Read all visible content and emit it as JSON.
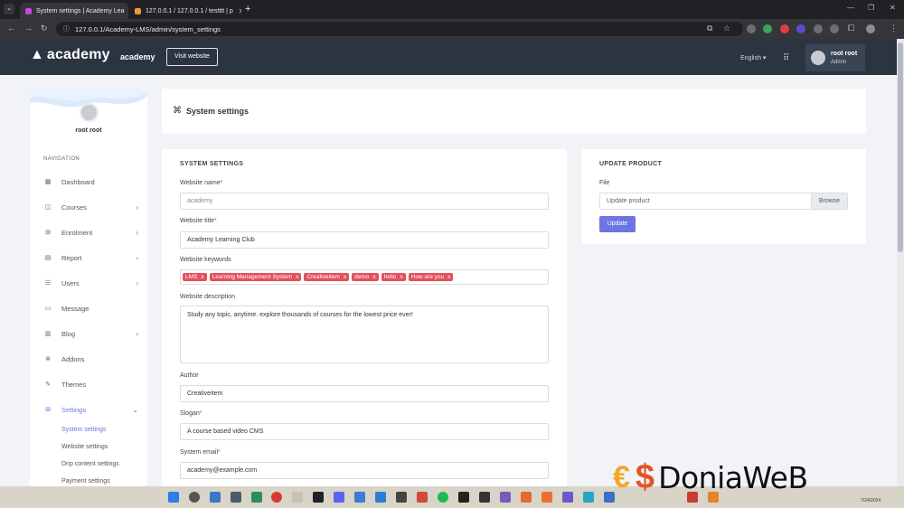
{
  "browser": {
    "tabs": [
      {
        "title": "System settings | Academy Lea",
        "active": true
      },
      {
        "title": "127.0.0.1 / 127.0.0.1 / testttt | p",
        "active": false
      }
    ],
    "url": "127.0.0.1/Academy-LMS/admin/system_settings"
  },
  "header": {
    "logo_text": "academy",
    "site_name": "academy",
    "visit_website": "Visit website",
    "language": "English",
    "user": {
      "name": "root root",
      "role": "Admin"
    }
  },
  "sidebar": {
    "profile_name": "root root",
    "nav_heading": "NAVIGATION",
    "items": [
      {
        "label": "Dashboard",
        "icon": "dashboard-icon",
        "chevron": false
      },
      {
        "label": "Courses",
        "icon": "courses-icon",
        "chevron": true
      },
      {
        "label": "Enrolment",
        "icon": "enrolment-icon",
        "chevron": true
      },
      {
        "label": "Report",
        "icon": "report-icon",
        "chevron": true
      },
      {
        "label": "Users",
        "icon": "users-icon",
        "chevron": true
      },
      {
        "label": "Message",
        "icon": "message-icon",
        "chevron": false
      },
      {
        "label": "Blog",
        "icon": "blog-icon",
        "chevron": true
      },
      {
        "label": "Addons",
        "icon": "addons-icon",
        "chevron": false
      },
      {
        "label": "Themes",
        "icon": "themes-icon",
        "chevron": false
      },
      {
        "label": "Settings",
        "icon": "settings-icon",
        "chevron": true,
        "active": true
      }
    ],
    "sub_items": [
      {
        "label": "System settings",
        "active": true
      },
      {
        "label": "Website settings"
      },
      {
        "label": "Drip content settings"
      },
      {
        "label": "Payment settings"
      }
    ]
  },
  "page": {
    "title": "System settings"
  },
  "system_settings": {
    "heading": "SYSTEM SETTINGS",
    "fields": {
      "website_name": {
        "label": "Website name",
        "required": "*",
        "placeholder": "academy"
      },
      "website_title": {
        "label": "Website title",
        "required": "*",
        "value": "Academy Learning Club"
      },
      "website_keywords": {
        "label": "Website keywords",
        "tags": [
          "LMS",
          "Learning Management System",
          "Creativeitem",
          "demo",
          "hello",
          "How are you"
        ]
      },
      "website_description": {
        "label": "Website description",
        "value": "Study any topic, anytime. explore thousands of courses for the lowest price ever!"
      },
      "author": {
        "label": "Author",
        "value": "Creativeitem"
      },
      "slogan": {
        "label": "Slogan",
        "required": "*",
        "value": "A course based video CMS"
      },
      "system_email": {
        "label": "System email",
        "required": "*",
        "value": "academy@example.com"
      }
    }
  },
  "update_product": {
    "heading": "UPDATE PRODUCT",
    "file_label": "File",
    "file_placeholder": "Update product",
    "browse": "Browse",
    "button": "Update"
  },
  "watermark": {
    "text": "DoniaWeB"
  },
  "taskbar": {
    "date": "7/24/2024"
  },
  "colors": {
    "accent": "#6c75e0",
    "header_bg": "#2c3442",
    "tag_bg": "#e5505a"
  }
}
